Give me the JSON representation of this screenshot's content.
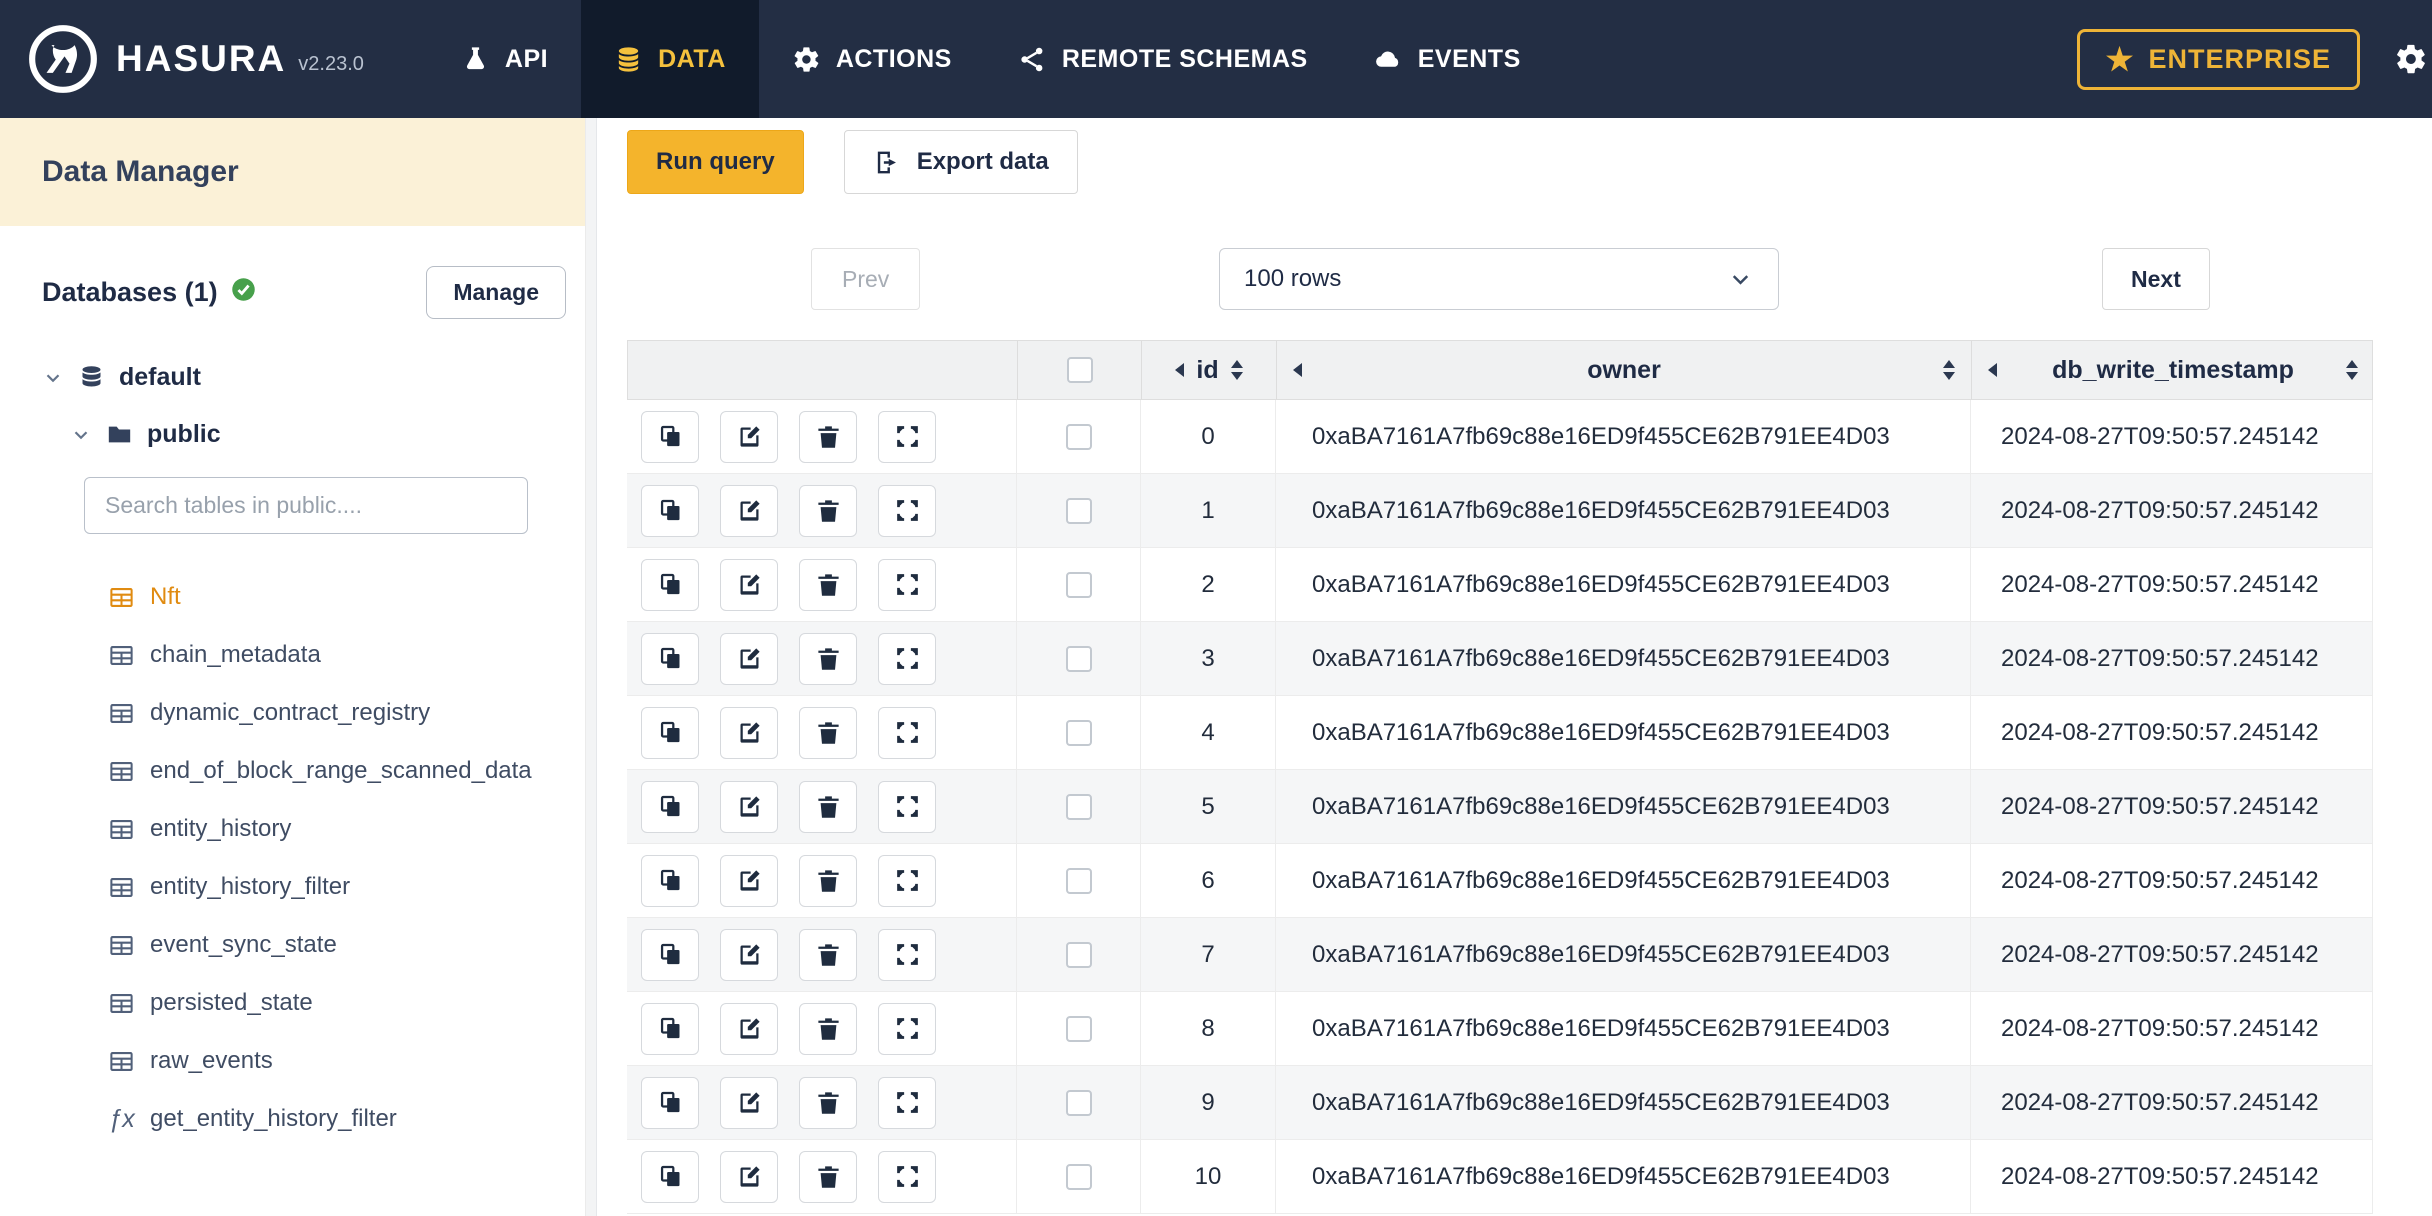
{
  "navbar": {
    "brand": "HASURA",
    "version": "v2.23.0",
    "items": [
      {
        "label": "API"
      },
      {
        "label": "DATA"
      },
      {
        "label": "ACTIONS"
      },
      {
        "label": "REMOTE SCHEMAS"
      },
      {
        "label": "EVENTS"
      }
    ],
    "enterprise_label": "ENTERPRISE"
  },
  "sidebar": {
    "title": "Data Manager",
    "databases_label": "Databases (1)",
    "manage_button": "Manage",
    "database_name": "default",
    "schema_name": "public",
    "search_placeholder": "Search tables in public....",
    "tables": [
      {
        "label": "Nft",
        "variant": "table-active"
      },
      {
        "label": "chain_metadata"
      },
      {
        "label": "dynamic_contract_registry"
      },
      {
        "label": "end_of_block_range_scanned_data"
      },
      {
        "label": "entity_history"
      },
      {
        "label": "entity_history_filter"
      },
      {
        "label": "event_sync_state"
      },
      {
        "label": "persisted_state"
      },
      {
        "label": "raw_events"
      },
      {
        "label": "get_entity_history_filter",
        "variant": "function"
      }
    ]
  },
  "toolbar": {
    "run_query_label": "Run query",
    "export_data_label": "Export data"
  },
  "pagination": {
    "prev_label": "Prev",
    "rows_label": "100 rows",
    "next_label": "Next"
  },
  "table": {
    "columns": [
      {
        "label": "id"
      },
      {
        "label": "owner"
      },
      {
        "label": "db_write_timestamp"
      }
    ],
    "rows": [
      {
        "id": "0",
        "owner": "0xaBA7161A7fb69c88e16ED9f455CE62B791EE4D03",
        "db_write_timestamp": "2024-08-27T09:50:57.245142"
      },
      {
        "id": "1",
        "owner": "0xaBA7161A7fb69c88e16ED9f455CE62B791EE4D03",
        "db_write_timestamp": "2024-08-27T09:50:57.245142"
      },
      {
        "id": "2",
        "owner": "0xaBA7161A7fb69c88e16ED9f455CE62B791EE4D03",
        "db_write_timestamp": "2024-08-27T09:50:57.245142"
      },
      {
        "id": "3",
        "owner": "0xaBA7161A7fb69c88e16ED9f455CE62B791EE4D03",
        "db_write_timestamp": "2024-08-27T09:50:57.245142"
      },
      {
        "id": "4",
        "owner": "0xaBA7161A7fb69c88e16ED9f455CE62B791EE4D03",
        "db_write_timestamp": "2024-08-27T09:50:57.245142"
      },
      {
        "id": "5",
        "owner": "0xaBA7161A7fb69c88e16ED9f455CE62B791EE4D03",
        "db_write_timestamp": "2024-08-27T09:50:57.245142"
      },
      {
        "id": "6",
        "owner": "0xaBA7161A7fb69c88e16ED9f455CE62B791EE4D03",
        "db_write_timestamp": "2024-08-27T09:50:57.245142"
      },
      {
        "id": "7",
        "owner": "0xaBA7161A7fb69c88e16ED9f455CE62B791EE4D03",
        "db_write_timestamp": "2024-08-27T09:50:57.245142"
      },
      {
        "id": "8",
        "owner": "0xaBA7161A7fb69c88e16ED9f455CE62B791EE4D03",
        "db_write_timestamp": "2024-08-27T09:50:57.245142"
      },
      {
        "id": "9",
        "owner": "0xaBA7161A7fb69c88e16ED9f455CE62B791EE4D03",
        "db_write_timestamp": "2024-08-27T09:50:57.245142"
      },
      {
        "id": "10",
        "owner": "0xaBA7161A7fb69c88e16ED9f455CE62B791EE4D03",
        "db_write_timestamp": "2024-08-27T09:50:57.245142"
      }
    ]
  },
  "colors": {
    "navbar_bg": "#232e44",
    "accent_amber": "#f4b42c",
    "enterprise_gold": "#eeb437",
    "active_table_orange": "#e08b11",
    "sidebar_header_cream": "#fbf1d7",
    "status_green": "#47a04b"
  }
}
